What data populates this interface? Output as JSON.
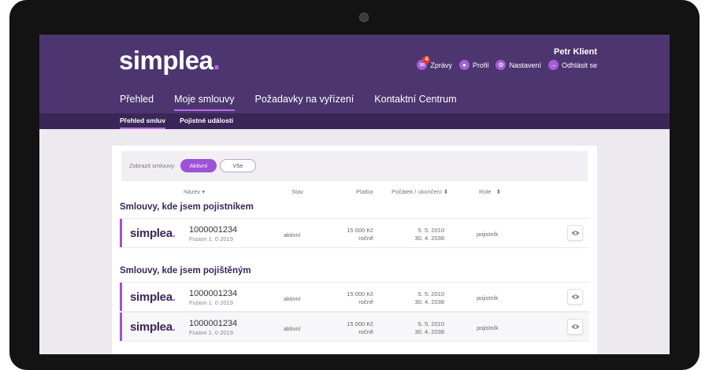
{
  "brand": {
    "name": "simplea",
    "accent": "#b86ae6",
    "header_bg": "#4d3570",
    "subnav_bg": "#3a2757",
    "primary": "#9d52d8"
  },
  "user": {
    "name": "Petr Klient"
  },
  "top_links": [
    {
      "label": "Zprávy",
      "icon": "mail-icon",
      "badge": "4"
    },
    {
      "label": "Profil",
      "icon": "user-icon"
    },
    {
      "label": "Nastavení",
      "icon": "gear-icon"
    },
    {
      "label": "Odhlásit se",
      "icon": "logout-arrow-icon"
    }
  ],
  "main_nav": [
    {
      "label": "Přehled"
    },
    {
      "label": "Moje smlouvy",
      "active": true
    },
    {
      "label": "Požadavky na vyřízení"
    },
    {
      "label": "Kontaktní Centrum"
    }
  ],
  "sub_nav": [
    {
      "label": "Přehled smluv",
      "active": true
    },
    {
      "label": "Pojistné události"
    }
  ],
  "filter": {
    "label": "Zobrazit smlouvy:",
    "options": [
      {
        "label": "Aktivní",
        "selected": true
      },
      {
        "label": "Vše"
      }
    ]
  },
  "columns": {
    "name": "Název",
    "status": "Stav",
    "payment": "Platba",
    "period": "Počátek / ukončení",
    "role": "Role"
  },
  "sections": [
    {
      "title": "Smlouvy, kde jsem pojistníkem",
      "rows": [
        {
          "logo": "simplea",
          "number": "1000001234",
          "product": "Fusion 1. 0 2019",
          "status": "aktivní",
          "amount": "15 000 Kč",
          "frequency": "ročně",
          "start": "5. 5. 2010",
          "end": "30. 4. 2038",
          "role": "pojistník"
        }
      ]
    },
    {
      "title": "Smlouvy, kde jsem pojištěným",
      "rows": [
        {
          "logo": "simplea",
          "number": "1000001234",
          "product": "Fusion 1. 0 2019",
          "status": "aktivní",
          "amount": "15 000 Kč",
          "frequency": "ročně",
          "start": "5. 5. 2010",
          "end": "30. 4. 2038",
          "role": "pojistník"
        },
        {
          "logo": "simplea",
          "number": "1000001234",
          "product": "Fusion 1. 0 2019",
          "status": "aktivní",
          "amount": "15 000 Kč",
          "frequency": "ročně",
          "start": "5. 5. 2010",
          "end": "30. 4. 2038",
          "role": "pojistník"
        }
      ]
    }
  ]
}
